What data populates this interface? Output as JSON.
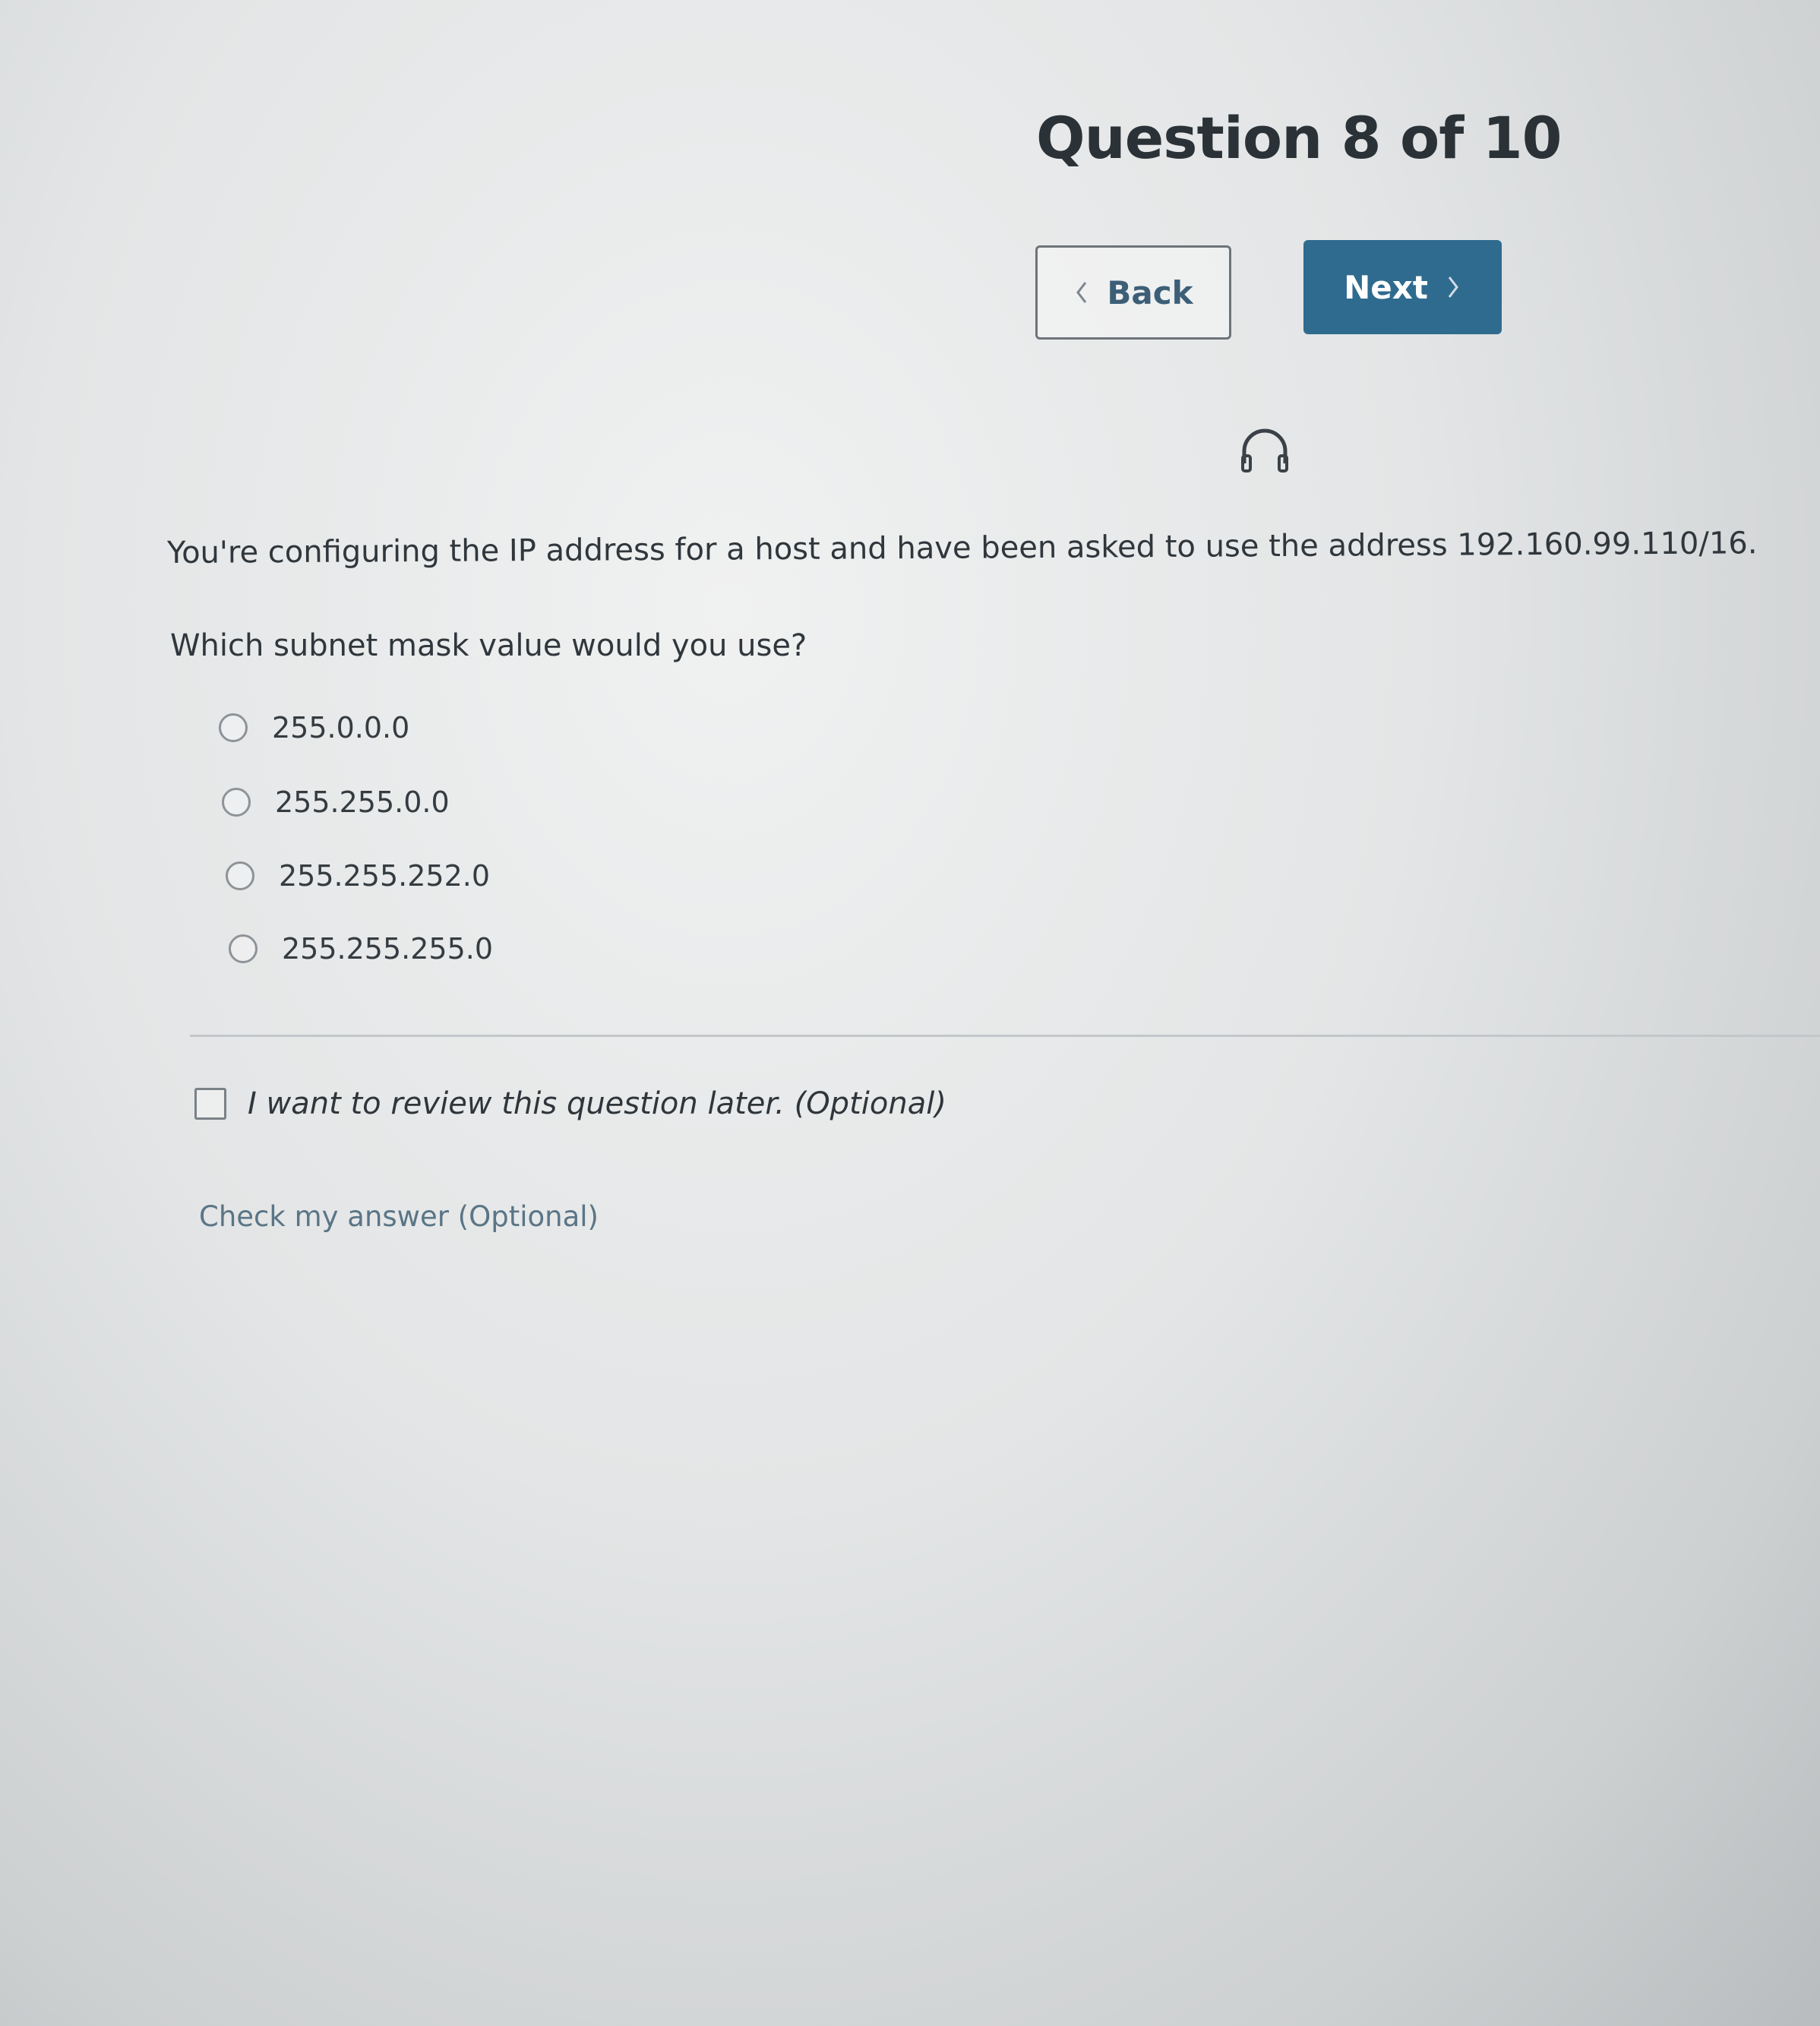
{
  "header": {
    "title": "Question 8 of 10"
  },
  "navigation": {
    "back_label": "Back",
    "next_label": "Next"
  },
  "icons": {
    "audio": "headphones-icon",
    "back": "chevron-left-icon",
    "next": "chevron-right-icon"
  },
  "question": {
    "text": "You're configuring the IP address for a host and have been asked to use the address 192.160.99.110/16.",
    "prompt": "Which subnet mask value would you use?",
    "options": [
      {
        "label": "255.0.0.0"
      },
      {
        "label": "255.255.0.0"
      },
      {
        "label": "255.255.252.0"
      },
      {
        "label": "255.255.255.0"
      }
    ]
  },
  "review": {
    "label": "I want to review this question later. (Optional)",
    "checked": false
  },
  "check_answer": {
    "label": "Check my answer (Optional)"
  },
  "colors": {
    "primary_button": "#2f6b8f",
    "link": "#5a7586"
  }
}
